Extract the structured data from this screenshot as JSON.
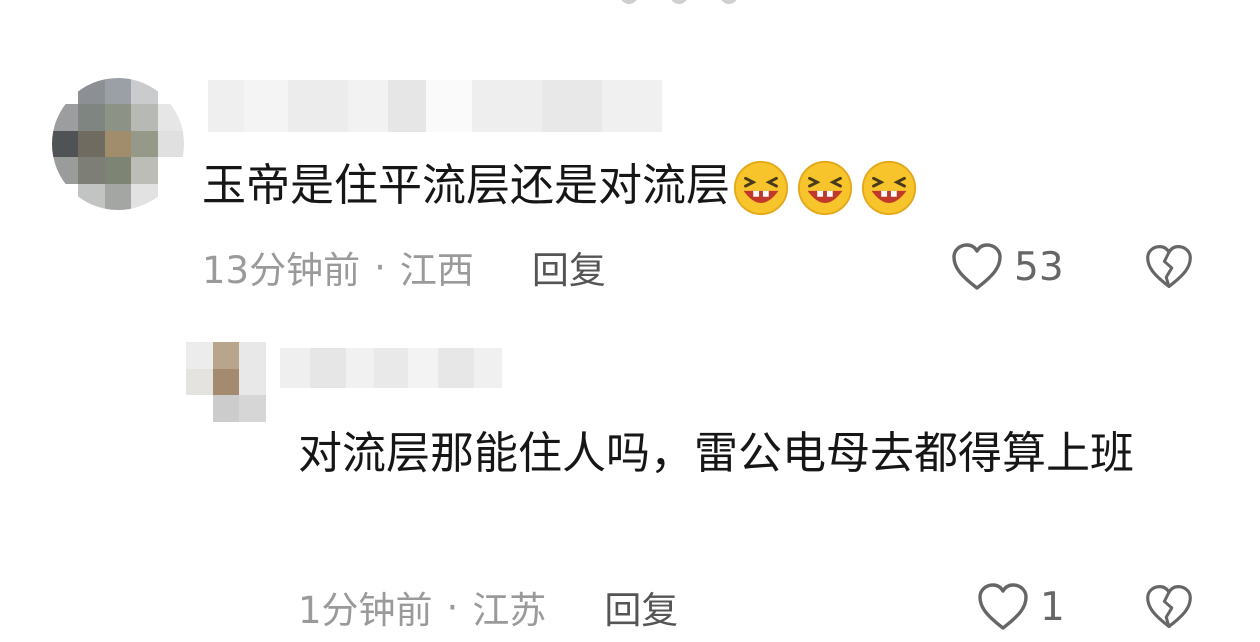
{
  "comments": [
    {
      "text": "玉帝是住平流层还是对流层",
      "emojis": [
        "laughing-emoji",
        "laughing-emoji",
        "laughing-emoji"
      ],
      "time": "13分钟前",
      "location": "江西",
      "reply_label": "回复",
      "likes": "53"
    },
    {
      "text": "对流层那能住人吗，雷公电母去都得算上班",
      "time": "1分钟前",
      "location": "江苏",
      "reply_label": "回复",
      "likes": "1"
    }
  ],
  "separator": "·",
  "colors": {
    "text": "#161616",
    "meta": "#9a9a9a",
    "reply": "#555555",
    "icon": "#666666",
    "emoji_face": "#f7c52b",
    "emoji_mouth": "#c0392b"
  },
  "icons": {
    "like": "heart-outline-icon",
    "dislike": "broken-heart-icon"
  }
}
